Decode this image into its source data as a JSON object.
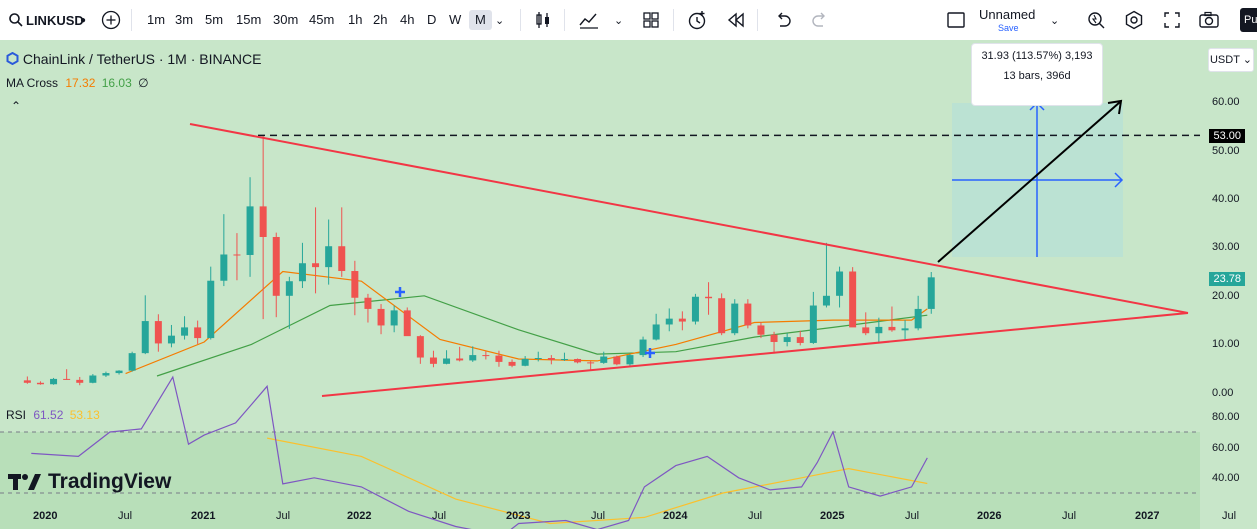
{
  "toolbar": {
    "symbol": "LINKUSD",
    "intervals": [
      "1m",
      "3m",
      "5m",
      "15m",
      "30m",
      "45m",
      "1h",
      "2h",
      "4h",
      "D",
      "W",
      "M"
    ],
    "active_interval": "M",
    "layout_name": "Unnamed",
    "save_label": "Save",
    "profile": "Pu"
  },
  "legend": {
    "title": "ChainLink / TetherUS · 1M · BINANCE",
    "ma_label": "MA Cross",
    "ma_fast": "17.32",
    "ma_slow": "16.03",
    "ma_extra": "∅",
    "rsi_label": "RSI",
    "rsi_value": "61.52",
    "rsi_ma": "53.13"
  },
  "price_axis": {
    "currency": "USDT",
    "ticks": [
      "60.00",
      "50.00",
      "40.00",
      "30.00",
      "20.00",
      "10.00",
      "0.00"
    ],
    "level_label": "53.00",
    "last_price": "23.78"
  },
  "rsi_axis": {
    "ticks": [
      "80.00",
      "60.00",
      "40.00"
    ]
  },
  "time_axis": {
    "labels": [
      "2020",
      "Jul",
      "2021",
      "Jul",
      "2022",
      "Jul",
      "2023",
      "Jul",
      "2024",
      "Jul",
      "2025",
      "Jul",
      "2026",
      "Jul",
      "2027",
      "Jul"
    ]
  },
  "measure_tooltip": {
    "line1": "31.93 (113.57%) 3,193",
    "line2": "13 bars, 396d"
  },
  "brand": {
    "name": "TradingView"
  },
  "colors": {
    "background": "#c8e6c9",
    "up": "#26a69a",
    "down": "#ef5350",
    "ma_fast": "#f57c00",
    "ma_slow": "#43a047",
    "trendline": "#f23645",
    "rsi": "#7e57c2",
    "rsi_ma": "#fbc02d"
  },
  "chart_data": {
    "type": "candlestick",
    "interval": "1M",
    "y_unit": "USDT",
    "ylim": [
      0,
      65
    ],
    "candles": [
      {
        "t": "2019-11",
        "o": 2.6,
        "h": 3.4,
        "l": 1.9,
        "c": 2.1
      },
      {
        "t": "2019-12",
        "o": 2.1,
        "h": 2.4,
        "l": 1.7,
        "c": 1.8
      },
      {
        "t": "2020-01",
        "o": 1.8,
        "h": 3.1,
        "l": 1.7,
        "c": 2.9
      },
      {
        "t": "2020-02",
        "o": 2.9,
        "h": 4.9,
        "l": 2.7,
        "c": 2.7
      },
      {
        "t": "2020-03",
        "o": 2.7,
        "h": 3.3,
        "l": 1.6,
        "c": 2.1
      },
      {
        "t": "2020-04",
        "o": 2.1,
        "h": 3.9,
        "l": 2.0,
        "c": 3.6
      },
      {
        "t": "2020-05",
        "o": 3.6,
        "h": 4.4,
        "l": 3.3,
        "c": 4.1
      },
      {
        "t": "2020-06",
        "o": 4.1,
        "h": 4.7,
        "l": 3.8,
        "c": 4.6
      },
      {
        "t": "2020-07",
        "o": 4.6,
        "h": 8.5,
        "l": 4.4,
        "c": 8.2
      },
      {
        "t": "2020-08",
        "o": 8.2,
        "h": 20.1,
        "l": 8.0,
        "c": 14.8
      },
      {
        "t": "2020-09",
        "o": 14.8,
        "h": 16.2,
        "l": 8.5,
        "c": 10.2
      },
      {
        "t": "2020-10",
        "o": 10.2,
        "h": 14.0,
        "l": 9.4,
        "c": 11.8
      },
      {
        "t": "2020-11",
        "o": 11.8,
        "h": 15.8,
        "l": 11.0,
        "c": 13.5
      },
      {
        "t": "2020-12",
        "o": 13.5,
        "h": 14.9,
        "l": 10.1,
        "c": 11.3
      },
      {
        "t": "2021-01",
        "o": 11.3,
        "h": 26.0,
        "l": 11.0,
        "c": 23.1
      },
      {
        "t": "2021-02",
        "o": 23.1,
        "h": 36.8,
        "l": 22.0,
        "c": 28.5
      },
      {
        "t": "2021-03",
        "o": 28.5,
        "h": 32.9,
        "l": 23.2,
        "c": 28.4
      },
      {
        "t": "2021-04",
        "o": 28.4,
        "h": 44.4,
        "l": 23.9,
        "c": 38.4
      },
      {
        "t": "2021-05",
        "o": 38.4,
        "h": 52.9,
        "l": 15.2,
        "c": 32.1
      },
      {
        "t": "2021-06",
        "o": 32.1,
        "h": 33.0,
        "l": 15.6,
        "c": 20.0
      },
      {
        "t": "2021-07",
        "o": 20.0,
        "h": 23.9,
        "l": 13.2,
        "c": 23.0
      },
      {
        "t": "2021-08",
        "o": 23.0,
        "h": 30.9,
        "l": 21.6,
        "c": 26.7
      },
      {
        "t": "2021-09",
        "o": 26.7,
        "h": 38.2,
        "l": 20.5,
        "c": 25.9
      },
      {
        "t": "2021-10",
        "o": 25.9,
        "h": 35.7,
        "l": 22.3,
        "c": 30.2
      },
      {
        "t": "2021-11",
        "o": 30.2,
        "h": 38.2,
        "l": 23.9,
        "c": 25.1
      },
      {
        "t": "2021-12",
        "o": 25.1,
        "h": 27.2,
        "l": 16.0,
        "c": 19.6
      },
      {
        "t": "2022-01",
        "o": 19.6,
        "h": 20.4,
        "l": 14.5,
        "c": 17.3
      },
      {
        "t": "2022-02",
        "o": 17.3,
        "h": 18.3,
        "l": 12.1,
        "c": 13.9
      },
      {
        "t": "2022-03",
        "o": 13.9,
        "h": 18.0,
        "l": 12.5,
        "c": 17.0
      },
      {
        "t": "2022-04",
        "o": 17.0,
        "h": 17.6,
        "l": 11.8,
        "c": 11.7
      },
      {
        "t": "2022-05",
        "o": 11.7,
        "h": 11.9,
        "l": 6.0,
        "c": 7.3
      },
      {
        "t": "2022-06",
        "o": 7.3,
        "h": 8.7,
        "l": 5.3,
        "c": 6.0
      },
      {
        "t": "2022-07",
        "o": 6.0,
        "h": 8.8,
        "l": 5.9,
        "c": 7.1
      },
      {
        "t": "2022-08",
        "o": 7.1,
        "h": 9.5,
        "l": 6.5,
        "c": 6.7
      },
      {
        "t": "2022-09",
        "o": 6.7,
        "h": 9.6,
        "l": 6.4,
        "c": 7.8
      },
      {
        "t": "2022-10",
        "o": 7.8,
        "h": 8.6,
        "l": 6.9,
        "c": 7.7
      },
      {
        "t": "2022-11",
        "o": 7.7,
        "h": 8.7,
        "l": 5.4,
        "c": 6.4
      },
      {
        "t": "2022-12",
        "o": 6.4,
        "h": 6.9,
        "l": 5.3,
        "c": 5.6
      },
      {
        "t": "2023-01",
        "o": 5.6,
        "h": 7.6,
        "l": 5.5,
        "c": 7.0
      },
      {
        "t": "2023-02",
        "o": 7.0,
        "h": 8.5,
        "l": 6.5,
        "c": 7.2
      },
      {
        "t": "2023-03",
        "o": 7.2,
        "h": 7.8,
        "l": 5.9,
        "c": 6.8
      },
      {
        "t": "2023-04",
        "o": 6.8,
        "h": 8.3,
        "l": 6.6,
        "c": 7.0
      },
      {
        "t": "2023-05",
        "o": 7.0,
        "h": 7.1,
        "l": 6.1,
        "c": 6.3
      },
      {
        "t": "2023-06",
        "o": 6.3,
        "h": 6.6,
        "l": 4.8,
        "c": 6.2
      },
      {
        "t": "2023-07",
        "o": 6.2,
        "h": 8.5,
        "l": 6.0,
        "c": 7.5
      },
      {
        "t": "2023-08",
        "o": 7.5,
        "h": 7.7,
        "l": 5.7,
        "c": 5.9
      },
      {
        "t": "2023-09",
        "o": 5.9,
        "h": 8.0,
        "l": 5.6,
        "c": 7.8
      },
      {
        "t": "2023-10",
        "o": 7.8,
        "h": 11.6,
        "l": 7.4,
        "c": 11.0
      },
      {
        "t": "2023-11",
        "o": 11.0,
        "h": 16.3,
        "l": 10.8,
        "c": 14.1
      },
      {
        "t": "2023-12",
        "o": 14.1,
        "h": 17.4,
        "l": 12.7,
        "c": 15.3
      },
      {
        "t": "2024-01",
        "o": 15.3,
        "h": 16.8,
        "l": 12.9,
        "c": 14.7
      },
      {
        "t": "2024-02",
        "o": 14.7,
        "h": 20.4,
        "l": 14.1,
        "c": 19.8
      },
      {
        "t": "2024-03",
        "o": 19.8,
        "h": 22.8,
        "l": 16.1,
        "c": 19.5
      },
      {
        "t": "2024-04",
        "o": 19.5,
        "h": 20.5,
        "l": 11.9,
        "c": 12.3
      },
      {
        "t": "2024-05",
        "o": 12.3,
        "h": 19.3,
        "l": 11.9,
        "c": 18.4
      },
      {
        "t": "2024-06",
        "o": 18.4,
        "h": 19.3,
        "l": 13.3,
        "c": 13.9
      },
      {
        "t": "2024-07",
        "o": 13.9,
        "h": 14.6,
        "l": 11.3,
        "c": 12.0
      },
      {
        "t": "2024-08",
        "o": 12.0,
        "h": 12.6,
        "l": 8.1,
        "c": 10.5
      },
      {
        "t": "2024-09",
        "o": 10.5,
        "h": 12.3,
        "l": 9.6,
        "c": 11.5
      },
      {
        "t": "2024-10",
        "o": 11.5,
        "h": 12.8,
        "l": 9.8,
        "c": 10.3
      },
      {
        "t": "2024-11",
        "o": 10.3,
        "h": 20.8,
        "l": 10.1,
        "c": 18.0
      },
      {
        "t": "2024-12",
        "o": 18.0,
        "h": 30.9,
        "l": 17.6,
        "c": 20.0
      },
      {
        "t": "2025-01",
        "o": 20.0,
        "h": 26.0,
        "l": 17.6,
        "c": 25.0
      },
      {
        "t": "2025-02",
        "o": 25.0,
        "h": 25.9,
        "l": 14.5,
        "c": 13.5
      },
      {
        "t": "2025-03",
        "o": 13.5,
        "h": 16.6,
        "l": 11.9,
        "c": 12.3
      },
      {
        "t": "2025-04",
        "o": 12.3,
        "h": 15.5,
        "l": 10.2,
        "c": 13.6
      },
      {
        "t": "2025-05",
        "o": 13.6,
        "h": 17.8,
        "l": 12.6,
        "c": 12.9
      },
      {
        "t": "2025-06",
        "o": 12.9,
        "h": 15.0,
        "l": 11.0,
        "c": 13.3
      },
      {
        "t": "2025-07",
        "o": 13.3,
        "h": 20.0,
        "l": 12.9,
        "c": 17.3
      },
      {
        "t": "2025-08",
        "o": 17.3,
        "h": 24.9,
        "l": 16.3,
        "c": 23.8
      }
    ],
    "ma_fast": [
      [
        2020.5,
        4.0
      ],
      [
        2021.0,
        10.5
      ],
      [
        2021.5,
        25.0
      ],
      [
        2022.0,
        23.0
      ],
      [
        2022.5,
        11.0
      ],
      [
        2023.0,
        7.0
      ],
      [
        2023.5,
        6.6
      ],
      [
        2024.0,
        10.0
      ],
      [
        2024.5,
        14.5
      ],
      [
        2025.0,
        15.0
      ],
      [
        2025.5,
        15.0
      ],
      [
        2025.6,
        17.3
      ]
    ],
    "ma_slow": [
      [
        2020.7,
        3.5
      ],
      [
        2021.3,
        10.0
      ],
      [
        2021.8,
        18.0
      ],
      [
        2022.4,
        20.0
      ],
      [
        2023.0,
        13.0
      ],
      [
        2023.5,
        8.0
      ],
      [
        2024.0,
        8.5
      ],
      [
        2024.5,
        11.5
      ],
      [
        2025.0,
        13.5
      ],
      [
        2025.6,
        16.0
      ]
    ],
    "rsi": [
      [
        2019.9,
        63
      ],
      [
        2020.2,
        62
      ],
      [
        2020.4,
        70
      ],
      [
        2020.6,
        71
      ],
      [
        2020.8,
        88
      ],
      [
        2020.9,
        66
      ],
      [
        2021.0,
        69
      ],
      [
        2021.2,
        73
      ],
      [
        2021.3,
        79
      ],
      [
        2021.4,
        85
      ],
      [
        2021.5,
        53
      ],
      [
        2021.7,
        55
      ],
      [
        2022.0,
        52
      ],
      [
        2022.3,
        44
      ],
      [
        2022.6,
        39
      ],
      [
        2022.9,
        36
      ],
      [
        2023.0,
        40
      ],
      [
        2023.3,
        41
      ],
      [
        2023.5,
        38
      ],
      [
        2023.7,
        41
      ],
      [
        2023.8,
        52
      ],
      [
        2024.0,
        59
      ],
      [
        2024.2,
        62
      ],
      [
        2024.4,
        55
      ],
      [
        2024.6,
        51
      ],
      [
        2024.8,
        52
      ],
      [
        2024.9,
        60
      ],
      [
        2025.0,
        70
      ],
      [
        2025.1,
        52
      ],
      [
        2025.3,
        49
      ],
      [
        2025.5,
        52
      ],
      [
        2025.6,
        61.52
      ]
    ],
    "rsi_ma": [
      [
        2021.4,
        68
      ],
      [
        2022.0,
        62
      ],
      [
        2022.6,
        48
      ],
      [
        2023.2,
        40
      ],
      [
        2023.8,
        42
      ],
      [
        2024.3,
        50
      ],
      [
        2024.8,
        55
      ],
      [
        2025.1,
        58
      ],
      [
        2025.6,
        53.13
      ]
    ],
    "horizontal_level": 53.0,
    "rsi_levels": [
      70,
      50,
      30
    ]
  }
}
